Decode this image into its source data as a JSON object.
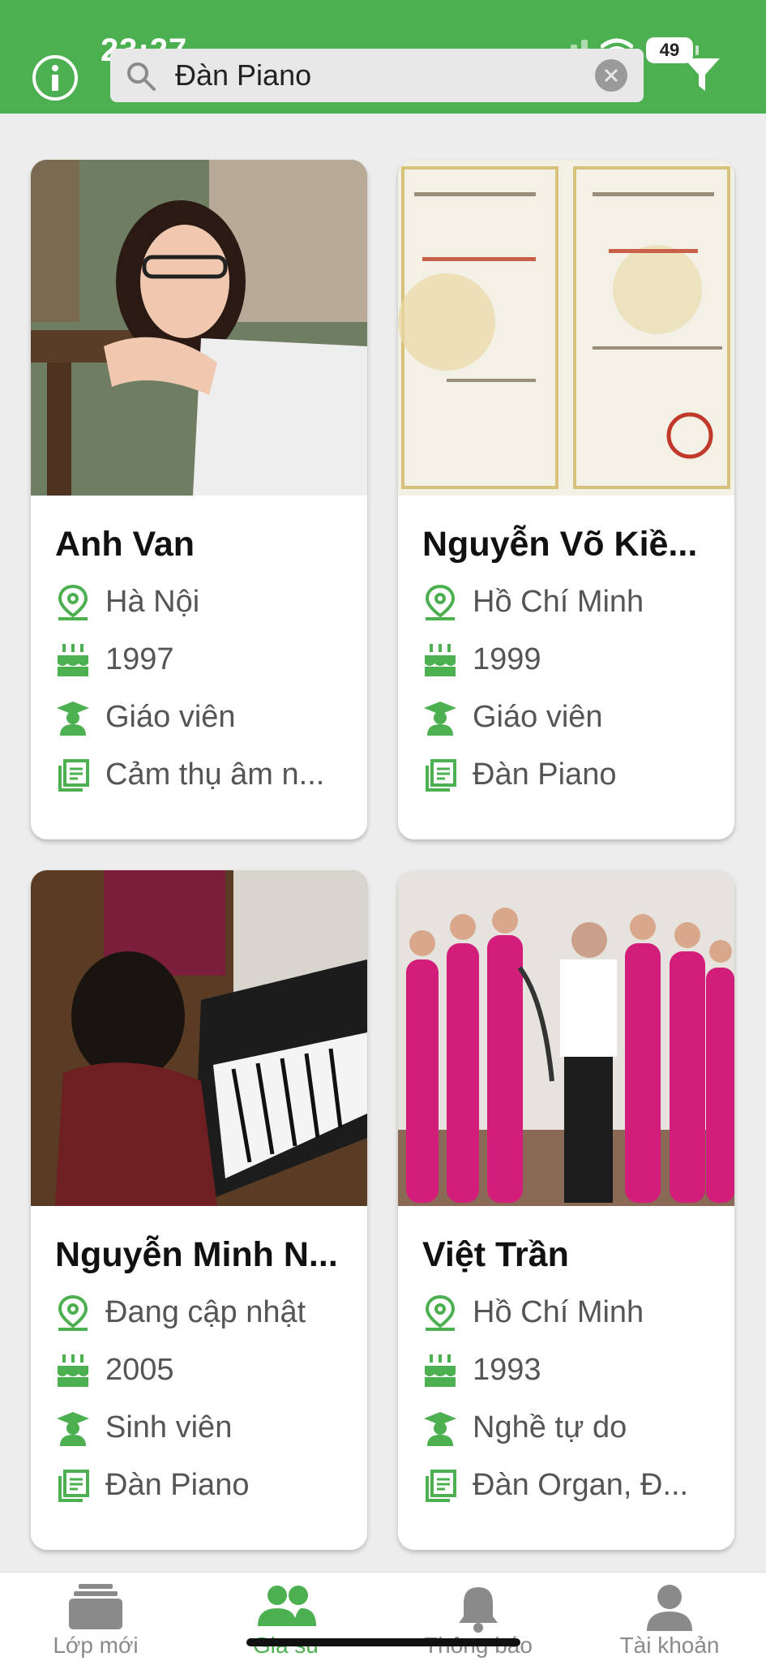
{
  "status_bar": {
    "time": "23:27",
    "battery": "49"
  },
  "search": {
    "value": "Đàn Piano"
  },
  "tutors": [
    {
      "name": "Anh Van",
      "location": "Hà Nội",
      "birth_year": "1997",
      "occupation": "Giáo viên",
      "subjects": "Cảm thụ âm n..."
    },
    {
      "name": "Nguyễn Võ Kiề...",
      "location": "Hồ Chí Minh",
      "birth_year": "1999",
      "occupation": "Giáo viên",
      "subjects": "Đàn Piano"
    },
    {
      "name": "Nguyễn Minh N...",
      "location": "Đang cập nhật",
      "birth_year": "2005",
      "occupation": "Sinh viên",
      "subjects": "Đàn Piano"
    },
    {
      "name": "Việt Trần",
      "location": "Hồ Chí Minh",
      "birth_year": "1993",
      "occupation": "Nghề tự do",
      "subjects": "Đàn Organ, Đ..."
    }
  ],
  "nav": [
    {
      "label": "Lớp mới",
      "icon": "stack-icon"
    },
    {
      "label": "Gia sư",
      "icon": "people-icon",
      "active": true
    },
    {
      "label": "Thông báo",
      "icon": "bell-icon"
    },
    {
      "label": "Tài khoản",
      "icon": "person-icon"
    }
  ],
  "colors": {
    "brand": "#4caf50",
    "text_secondary": "#555555",
    "nav_inactive": "#8a8a8a"
  }
}
